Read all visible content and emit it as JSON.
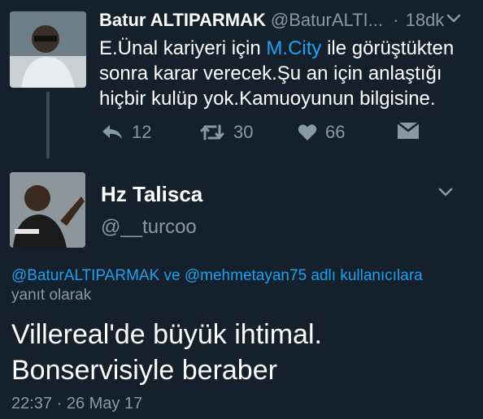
{
  "parent_tweet": {
    "author_name": "Batur ALTIPARMAK",
    "author_handle": "@BaturALTI...",
    "separator": "·",
    "time_ago": "18dk",
    "text_before_link": "E.Ünal kariyeri için ",
    "link_text": "M.City",
    "text_after_link": " ile görüştükten sonra karar verecek.Şu an için anlaştığı hiçbir kulüp yok.Kamuoyunun bilgisine.",
    "actions": {
      "reply_count": "12",
      "retweet_count": "30",
      "like_count": "66"
    },
    "icons": [
      "avatar",
      "chevron-down-icon",
      "reply-icon",
      "retweet-icon",
      "heart-icon",
      "direct-message-icon"
    ]
  },
  "reply_tweet": {
    "author_name": "Hz Talisca",
    "author_handle": "@__turcoo",
    "reply_to_mention1": "@BaturALTIPARMAK",
    "reply_to_connector": " ve ",
    "reply_to_mention2": "@mehmetayan75",
    "reply_to_suffix": " adlı kullanıcılara",
    "reply_to_line2": "yanıt olarak",
    "text_line1": "Villereal'de büyük ihtimal.",
    "text_line2": "Bonservisiyle beraber",
    "timestamp": "22:37 · 26 May 17"
  },
  "colors": {
    "background": "#14202c",
    "primary_text": "#ffffff",
    "secondary_text": "#8899a6",
    "link": "#1da1f2",
    "thread_line": "#3c4a57"
  }
}
